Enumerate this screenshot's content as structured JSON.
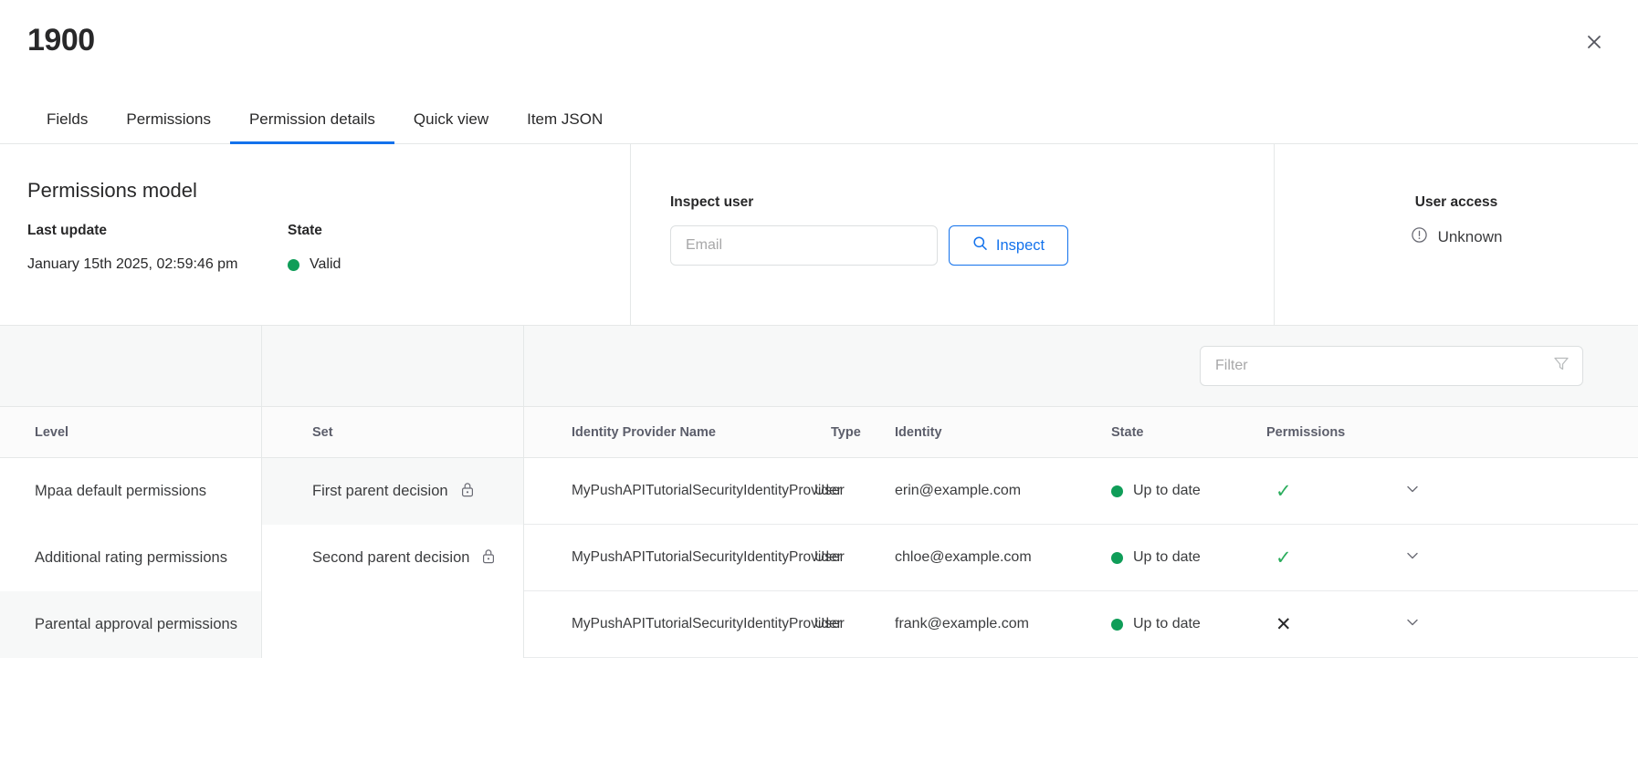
{
  "header": {
    "title": "1900",
    "close_icon": "close-icon"
  },
  "tabs": [
    {
      "label": "Fields",
      "active": false
    },
    {
      "label": "Permissions",
      "active": false
    },
    {
      "label": "Permission details",
      "active": true
    },
    {
      "label": "Quick view",
      "active": false
    },
    {
      "label": "Item JSON",
      "active": false
    }
  ],
  "permissions_model": {
    "title": "Permissions model",
    "last_update_label": "Last update",
    "last_update_value": "January 15th 2025, 02:59:46 pm",
    "state_label": "State",
    "state_value": "Valid",
    "state_color": "#0f9d58"
  },
  "inspect_user": {
    "title": "Inspect user",
    "email_placeholder": "Email",
    "email_value": "",
    "button_label": "Inspect",
    "button_icon": "magnifier-icon",
    "accent_color": "#1372ec"
  },
  "user_access": {
    "title": "User access",
    "status": "Unknown",
    "status_icon": "info-circle-icon"
  },
  "filter": {
    "placeholder": "Filter",
    "value": "",
    "icon": "funnel-icon"
  },
  "table": {
    "columns": [
      "Level",
      "Set",
      "Identity Provider Name",
      "Type",
      "Identity",
      "State",
      "Permissions"
    ],
    "levels": [
      {
        "label": "Mpaa default permissions",
        "shaded": false
      },
      {
        "label": "Additional rating permissions",
        "shaded": false
      },
      {
        "label": "Parental approval permissions",
        "shaded": true
      }
    ],
    "sets": [
      {
        "label": "First parent decision",
        "locked": true,
        "shaded": true
      },
      {
        "label": "Second parent decision",
        "locked": true,
        "shaded": false
      }
    ],
    "rows": [
      {
        "identity_provider_name": "MyPushAPITutorialSecurityIdentityProvider",
        "type": "User",
        "identity": "erin@example.com",
        "state": "Up to date",
        "state_color": "#0f9d58",
        "permission": "allowed",
        "permission_glyph": "✓",
        "chevron": "chevron-down-icon"
      },
      {
        "identity_provider_name": "MyPushAPITutorialSecurityIdentityProvider",
        "type": "User",
        "identity": "chloe@example.com",
        "state": "Up to date",
        "state_color": "#0f9d58",
        "permission": "allowed",
        "permission_glyph": "✓",
        "chevron": "chevron-down-icon"
      },
      {
        "identity_provider_name": "MyPushAPITutorialSecurityIdentityProvider",
        "type": "User",
        "identity": "frank@example.com",
        "state": "Up to date",
        "state_color": "#0f9d58",
        "permission": "denied",
        "permission_glyph": "✕",
        "chevron": "chevron-down-icon"
      }
    ]
  }
}
